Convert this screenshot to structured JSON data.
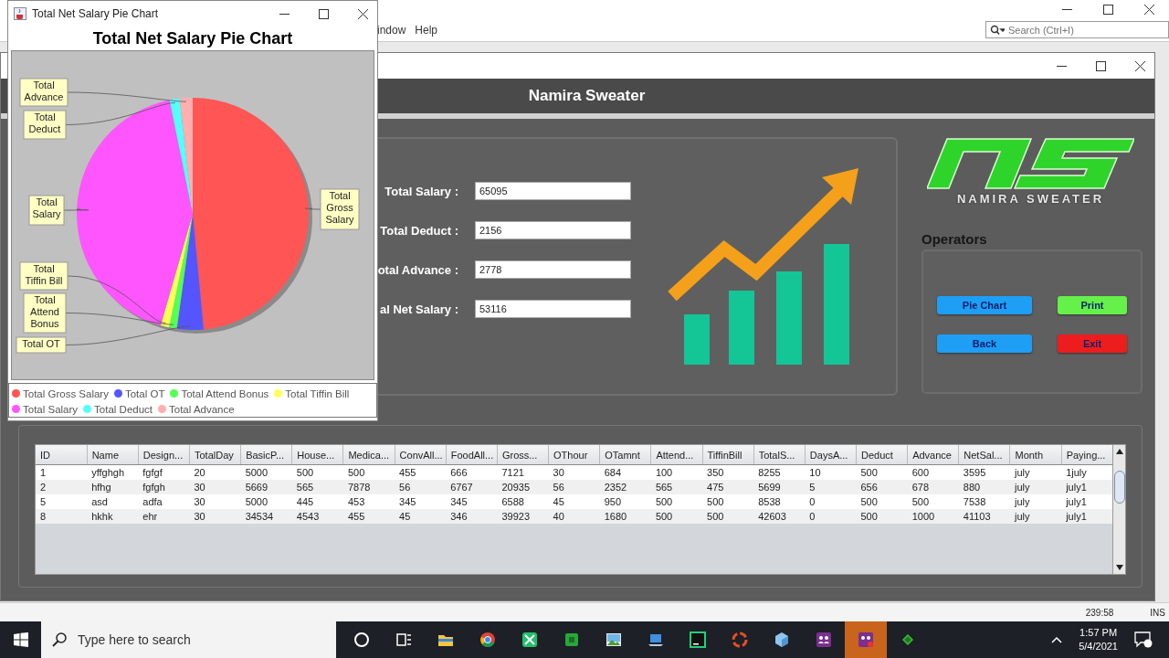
{
  "ide": {
    "menu": [
      "indow",
      "Help"
    ],
    "search": {
      "placeholder": "Search (Ctrl+I)"
    },
    "status": {
      "position": "239:58",
      "mode": "INS"
    }
  },
  "pie_window": {
    "title": "Total Net Salary Pie Chart",
    "chart_data": {
      "type": "pie",
      "title": "Total Net Salary Pie Chart",
      "categories": [
        "Total Gross Salary",
        "Total OT",
        "Total Attend Bonus",
        "Total Tiffin Bill",
        "Total Salary",
        "Total Deduct",
        "Total Advance"
      ],
      "values": [
        48.5,
        3.69,
        1.08,
        1.19,
        42.33,
        1.4,
        1.81
      ],
      "colors": [
        "#ff5555",
        "#5555ff",
        "#55ff55",
        "#ffff55",
        "#ff55ff",
        "#55ffff",
        "#ffafaf"
      ]
    },
    "slice_labels": [
      [
        "Total",
        "Advance"
      ],
      [
        "Total",
        "Deduct"
      ],
      [
        "Total",
        "Salary"
      ],
      [
        "Total",
        "Gross",
        "Salary"
      ],
      [
        "Total",
        "Tiffin Bill"
      ],
      [
        "Total",
        "Attend",
        "Bonus"
      ],
      [
        "Total OT"
      ]
    ]
  },
  "main_window": {
    "header": "Namira Sweater",
    "fields": [
      {
        "label": "Total Salary :",
        "value": "65095"
      },
      {
        "label": "Total Deduct :",
        "value": "2156"
      },
      {
        "label": "otal Advance :",
        "value": "2778"
      },
      {
        "label": "al Net Salary :",
        "value": "53116"
      }
    ],
    "logo_text": "NAMIRA SWEATER",
    "operators": {
      "title": "Operators",
      "buttons": [
        {
          "label": "Pie Chart",
          "color": "#1e9ef5"
        },
        {
          "label": "Print",
          "color": "#66f04a"
        },
        {
          "label": "Back",
          "color": "#1e9ef5"
        },
        {
          "label": "Exit",
          "color": "#ee1d1d"
        }
      ]
    },
    "table": {
      "columns": [
        "ID",
        "Name",
        "Design...",
        "TotalDay",
        "BasicP...",
        "House...",
        "Medica...",
        "ConvAll...",
        "FoodAll...",
        "Gross...",
        "OThour",
        "OTamnt",
        "Attend...",
        "TiffinBill",
        "TotalS...",
        "DaysA...",
        "Deduct",
        "Advance",
        "NetSal...",
        "Month",
        "Paying..."
      ],
      "rows": [
        [
          "1",
          "yffghgh",
          "fgfgf",
          "20",
          "5000",
          "500",
          "500",
          "455",
          "666",
          "7121",
          "30",
          "684",
          "100",
          "350",
          "8255",
          "10",
          "500",
          "600",
          "3595",
          "july",
          "1july"
        ],
        [
          "2",
          "hfhg",
          "fgfgh",
          "30",
          "5669",
          "565",
          "7878",
          "56",
          "6767",
          "20935",
          "56",
          "2352",
          "565",
          "475",
          "5699",
          "5",
          "656",
          "678",
          "880",
          "july",
          "july1"
        ],
        [
          "5",
          "asd",
          "adfa",
          "30",
          "5000",
          "445",
          "453",
          "345",
          "345",
          "6588",
          "45",
          "950",
          "500",
          "500",
          "8538",
          "0",
          "500",
          "500",
          "7538",
          "july",
          "july1"
        ],
        [
          "8",
          "hkhk",
          "ehr",
          "30",
          "34534",
          "4543",
          "455",
          "45",
          "346",
          "39923",
          "40",
          "1680",
          "500",
          "500",
          "42603",
          "0",
          "500",
          "1000",
          "41103",
          "july",
          "july1"
        ]
      ]
    }
  },
  "taskbar": {
    "search_placeholder": "Type here to search",
    "time": "1:57 PM",
    "date": "5/4/2021"
  }
}
